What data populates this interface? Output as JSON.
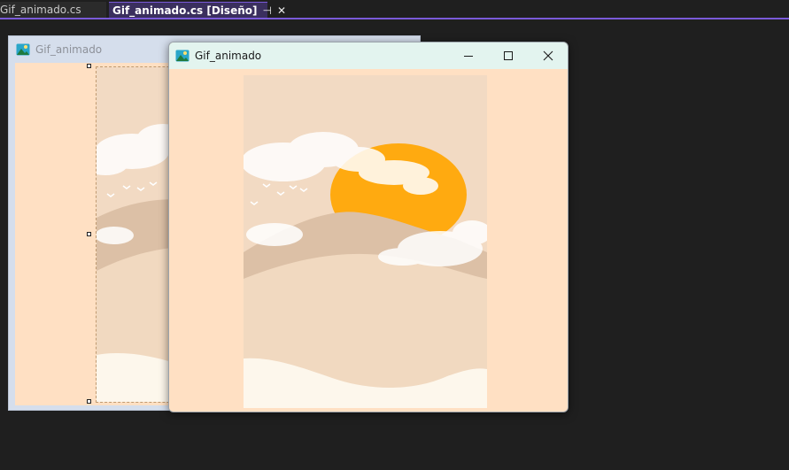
{
  "tabs": [
    {
      "label": "Gif_animado.cs",
      "active": false
    },
    {
      "label": "Gif_animado.cs [Diseño]",
      "active": true,
      "pin_icon": "⊣",
      "close_icon": "✕"
    }
  ],
  "designer": {
    "form_title": "Gif_animado",
    "icon": "picture-icon"
  },
  "runtime": {
    "window_title": "Gif_animado",
    "icon": "picture-icon",
    "minimize_glyph": "—",
    "maximize_glyph": "☐",
    "close_glyph": "✕"
  },
  "colors": {
    "ide_background": "#1f1f1f",
    "accent": "#7a5ad9",
    "form_backcolor": "#ffe0c3",
    "sun": "#ffaa10",
    "sand_light": "#fdf7ec",
    "dune": "#f1d9c0"
  }
}
